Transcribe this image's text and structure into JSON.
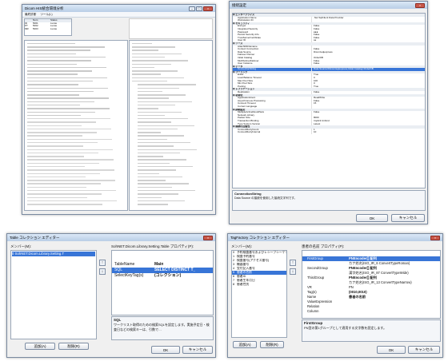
{
  "win1": {
    "title": "Dicom HIS統合環境分析",
    "menu": [
      "最終診断",
      "ツール(L)"
    ],
    "table": {
      "headers": [
        "",
        "Num",
        "Status"
      ],
      "rows": [
        [
          "ID",
          "5001",
          "Lucas"
        ],
        [
          "PT",
          "5002",
          "Lucas"
        ],
        [
          "MR",
          "5003",
          "Lucas"
        ]
      ]
    }
  },
  "win2": {
    "title": "接続設定",
    "groups": [
      {
        "name": "エンタープライズ",
        "rows": [
          [
            "Application Name",
            ".Net SqlClient Data Provider"
          ],
          [
            "Workstation ID",
            ""
          ]
        ]
      },
      {
        "name": "セキュリティ",
        "rows": [
          [
            "Encrypt",
            "False"
          ],
          [
            "Integrated Security",
            "False"
          ],
          [
            "Password",
            "●●●"
          ],
          [
            "Persist Security Info",
            "False"
          ],
          [
            "TrustServerCertificate",
            "False"
          ],
          [
            "User ID",
            "sa"
          ]
        ]
      },
      {
        "name": "ソース",
        "rows": [
          [
            "AttachDbFilename",
            ""
          ],
          [
            "Context Connection",
            "False"
          ],
          [
            "Data Source",
            "Dicom\\sqlexpress"
          ],
          [
            "Failover Partner",
            ""
          ],
          [
            "Initial Catalog",
            "OrderDB"
          ],
          [
            "MultiSubnetFailover",
            "False"
          ],
          [
            "User Instance",
            "False"
          ]
        ]
      },
      {
        "name": "データ",
        "rows": [
          [
            "ConnectionString",
            "Data Source=Dicom\\sqlexpress;Initial Catalog=OrderDB"
          ]
        ]
      },
      {
        "name": "プーリング",
        "rows": [
          [
            "Enlist",
            "True"
          ],
          [
            "Load Balance Timeout",
            "0"
          ],
          [
            "Max Pool Size",
            "100"
          ],
          [
            "Min Pool Size",
            "0"
          ],
          [
            "Pooling",
            "True"
          ]
        ]
      },
      {
        "name": "レプリケーション",
        "rows": [
          [
            "Replication",
            "False"
          ]
        ]
      },
      {
        "name": "初期化",
        "rows": [
          [
            "ApplicationIntent",
            "ReadWrite"
          ],
          [
            "Asynchronous Processing",
            "False"
          ],
          [
            "Connect Timeout",
            "15"
          ],
          [
            "Current Language",
            ""
          ]
        ]
      },
      {
        "name": "詳細設定",
        "rows": [
          [
            "MultipleActiveResultSets",
            "False"
          ],
          [
            "Network Library",
            ""
          ],
          [
            "Packet Size",
            "8000"
          ],
          [
            "Transaction Binding",
            "Implicit Unbind"
          ],
          [
            "Type System Version",
            "Latest"
          ]
        ]
      },
      {
        "name": "接続の回復性",
        "rows": [
          [
            "ConnectRetryCount",
            "1"
          ],
          [
            "ConnectRetryInterval",
            "10"
          ]
        ]
      }
    ],
    "desc_title": "ConnectionString",
    "desc_text": "Data Source の接続を使用した接続文字列です。",
    "ok": "OK",
    "cancel": "キャンセル"
  },
  "win3": {
    "title": "Table コレクション エディター",
    "members_label": "メンバー(M):",
    "member_item": "SohNET.Dicom.Library.Setting.T",
    "index": "0",
    "props_label": "SohNET.Dicom.Library.Setting.Table プロパティ(P):",
    "props": [
      [
        "TableName",
        "Main"
      ],
      [
        "SQL",
        "SELECT DISTINCT T_"
      ],
      [
        "SelectKeyTag(s)",
        "(コレクション)"
      ]
    ],
    "desc_title": "SQL",
    "desc_text": "ワークリスト取得のための検索SQLを設定します。実施予定日・検査日などの検索キーは、引数で…",
    "add": "追加(A)",
    "remove": "削除(R)",
    "ok": "OK",
    "cancel": "キャンセル"
  },
  "win4": {
    "title": "TagFactory コレクション エディター",
    "members_label": "メンバー(M):",
    "members": [
      [
        "0",
        "予約検査番号およびレシーブシーケンス"
      ],
      [
        "1",
        "検査予約番号"
      ],
      [
        "2",
        "検査番号(アクセス番号)"
      ],
      [
        "3",
        "機器番号"
      ],
      [
        "4",
        "受付記入番号"
      ],
      [
        "5",
        "患者の名前"
      ],
      [
        "6",
        "患者ID"
      ],
      [
        "7",
        "患者生年月日"
      ],
      [
        "8",
        "患者性別"
      ]
    ],
    "props_label": "患者の名前 プロパティ(P):",
    "props": [
      [
        "FirstGroup",
        "PNEncoder[] 配列"
      ],
      [
        "",
        "カナ姓名(ISO_IR_6 ConvertTypeRoman)"
      ],
      [
        "SecondGroup",
        "PNEncoder[] 配列"
      ],
      [
        "",
        "漢字姓名(ISO_IR_87 ConvertTypeWide)"
      ],
      [
        "ThirdGroup",
        "PNEncoder[] 配列"
      ],
      [
        "",
        "カナ姓名(ISO_IR_13 ConvertTypeNarrow)"
      ],
      [
        "VR",
        "PN"
      ],
      [
        "Tag(s)",
        "(0010,0010)"
      ],
      [
        "Name",
        "患者の名前"
      ],
      [
        "ValueExpression",
        ""
      ],
      [
        "Relation",
        ""
      ],
      [
        "Column",
        ""
      ]
    ],
    "desc_title": "FirstGroup",
    "desc_text": "PN型の第1グループとして適用する文字数を設定します。",
    "add": "追加(A)",
    "remove": "削除(R)",
    "ok": "OK",
    "cancel": "キャンセル"
  },
  "colors": {
    "selection": "#3875d7",
    "titlebar": "#c7d8ee",
    "close": "#c8584a"
  }
}
